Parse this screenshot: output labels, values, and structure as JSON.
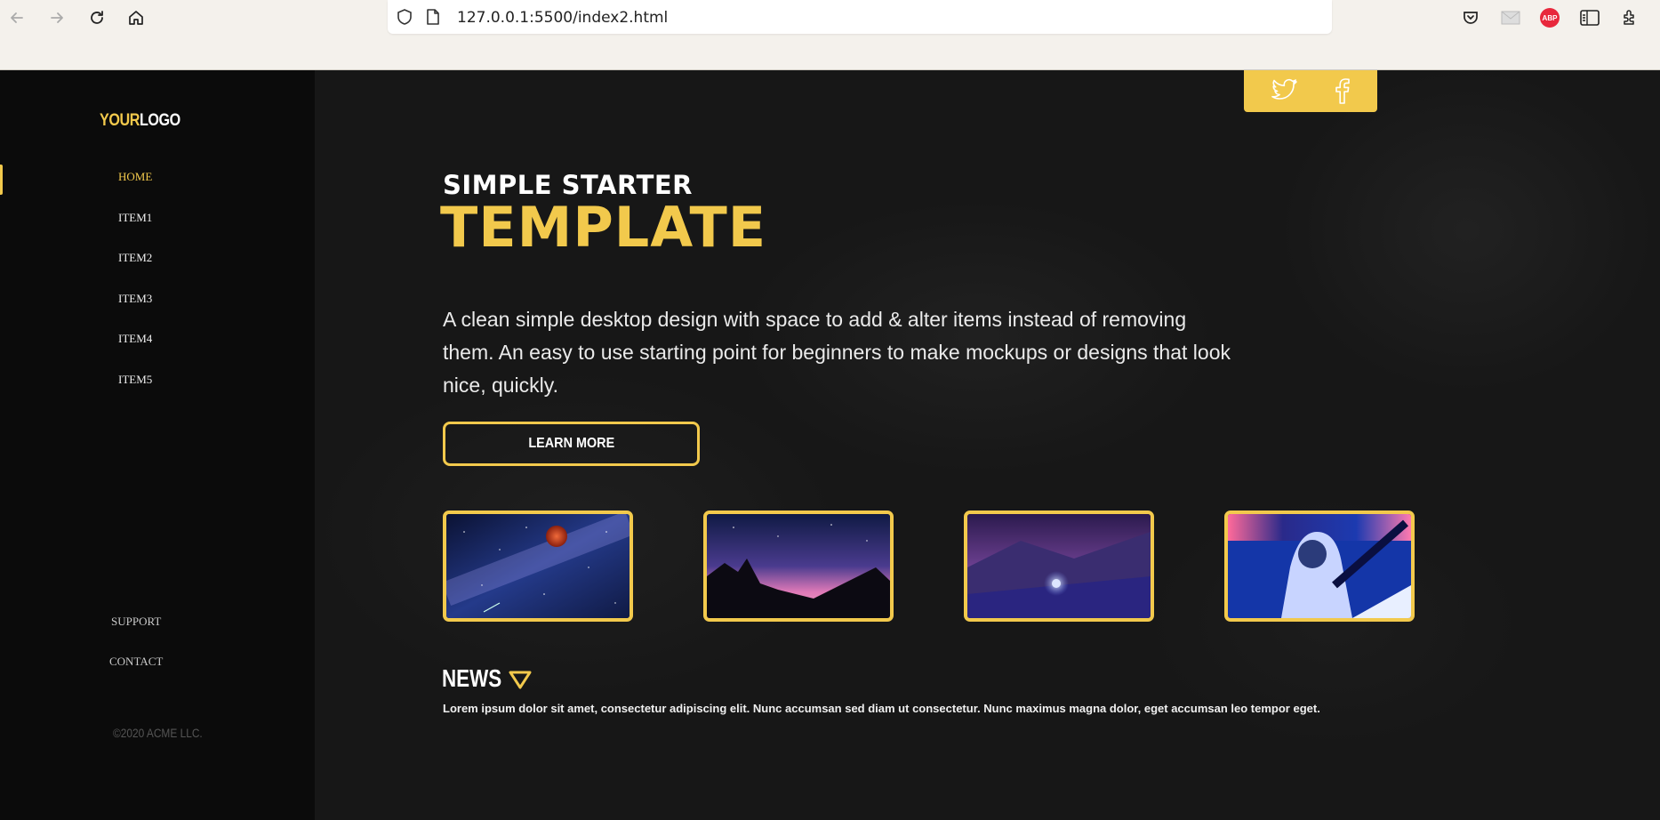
{
  "browser": {
    "url": "127.0.0.1:5500/index2.html"
  },
  "logo": {
    "part1": "YOUR",
    "part2": "LOGO"
  },
  "sidebar": {
    "items": [
      {
        "label": "HOME",
        "active": true
      },
      {
        "label": "ITEM1"
      },
      {
        "label": "ITEM2"
      },
      {
        "label": "ITEM3"
      },
      {
        "label": "ITEM4"
      },
      {
        "label": "ITEM5"
      }
    ],
    "support": "SUPPORT",
    "contact": "CONTACT",
    "copyright": "©2020 ACME LLC."
  },
  "social": {
    "icons": [
      "twitter-icon",
      "facebook-icon"
    ]
  },
  "hero": {
    "subtitle": "SIMPLE STARTER",
    "title": "TEMPLATE",
    "description": "A clean simple desktop design with space to add & alter items instead of removing them. An easy to use starting point for beginners to make mockups or designs that look nice, quickly.",
    "button": "LEARN MORE"
  },
  "gallery": [
    "night-sky-moon-image",
    "aurora-sky-image",
    "purple-snow-orb-image",
    "neon-statue-image"
  ],
  "news": {
    "title": "NEWS",
    "text": "Lorem ipsum dolor sit amet, consectetur adipiscing elit. Nunc accumsan sed diam ut consectetur. Nunc maximus magna dolor, eget accumsan leo tempor eget."
  },
  "colors": {
    "accent": "#f2c94c",
    "sidebar": "#0b0b0b",
    "background": "#171717"
  }
}
